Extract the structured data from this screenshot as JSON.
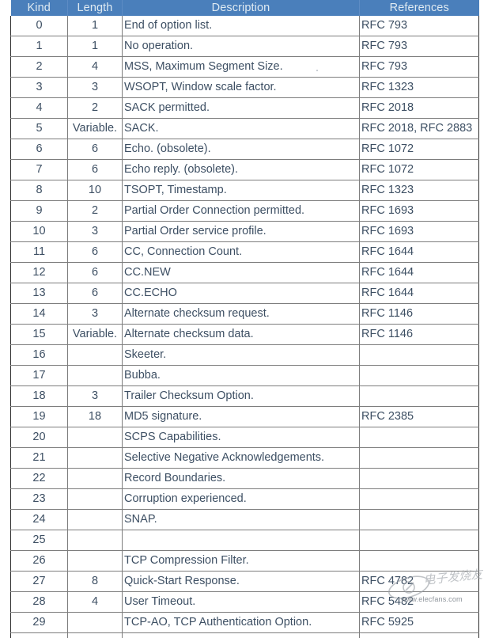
{
  "table": {
    "headers": {
      "kind": "Kind",
      "length": "Length",
      "description": "Description",
      "references": "References"
    },
    "rows": [
      {
        "kind": "0",
        "length": "1",
        "description": "End of option list.",
        "references": "RFC 793"
      },
      {
        "kind": "1",
        "length": "1",
        "description": "No operation.",
        "references": "RFC 793"
      },
      {
        "kind": "2",
        "length": "4",
        "description": "MSS, Maximum Segment Size.",
        "references": "RFC 793"
      },
      {
        "kind": "3",
        "length": "3",
        "description": "WSOPT, Window scale factor.",
        "references": "RFC 1323"
      },
      {
        "kind": "4",
        "length": "2",
        "description": "SACK permitted.",
        "references": "RFC 2018"
      },
      {
        "kind": "5",
        "length": "Variable.",
        "description": "SACK.",
        "references": "RFC 2018, RFC 2883"
      },
      {
        "kind": "6",
        "length": "6",
        "description": "Echo. (obsolete).",
        "references": "RFC 1072"
      },
      {
        "kind": "7",
        "length": "6",
        "description": "Echo reply. (obsolete).",
        "references": "RFC 1072"
      },
      {
        "kind": "8",
        "length": "10",
        "description": "TSOPT, Timestamp.",
        "references": "RFC 1323"
      },
      {
        "kind": "9",
        "length": "2",
        "description": "Partial Order Connection permitted.",
        "references": "RFC 1693"
      },
      {
        "kind": "10",
        "length": "3",
        "description": "Partial Order service profile.",
        "references": "RFC 1693"
      },
      {
        "kind": "11",
        "length": "6",
        "description": "CC, Connection Count.",
        "references": "RFC 1644"
      },
      {
        "kind": "12",
        "length": "6",
        "description": "CC.NEW",
        "references": "RFC 1644"
      },
      {
        "kind": "13",
        "length": "6",
        "description": "CC.ECHO",
        "references": "RFC 1644"
      },
      {
        "kind": "14",
        "length": "3",
        "description": "Alternate checksum request.",
        "references": "RFC 1146"
      },
      {
        "kind": "15",
        "length": "Variable.",
        "description": "Alternate checksum data.",
        "references": "RFC 1146"
      },
      {
        "kind": "16",
        "length": "",
        "description": "Skeeter.",
        "references": ""
      },
      {
        "kind": "17",
        "length": "",
        "description": "Bubba.",
        "references": ""
      },
      {
        "kind": "18",
        "length": "3",
        "description": "Trailer Checksum Option.",
        "references": ""
      },
      {
        "kind": "19",
        "length": "18",
        "description": "MD5 signature.",
        "references": "RFC 2385"
      },
      {
        "kind": "20",
        "length": "",
        "description": "SCPS Capabilities.",
        "references": ""
      },
      {
        "kind": "21",
        "length": "",
        "description": "Selective Negative Acknowledgements.",
        "references": ""
      },
      {
        "kind": "22",
        "length": "",
        "description": "Record Boundaries.",
        "references": ""
      },
      {
        "kind": "23",
        "length": "",
        "description": "Corruption experienced.",
        "references": ""
      },
      {
        "kind": "24",
        "length": "",
        "description": "SNAP.",
        "references": ""
      },
      {
        "kind": "25",
        "length": "",
        "description": "",
        "references": ""
      },
      {
        "kind": "26",
        "length": "",
        "description": "TCP Compression Filter.",
        "references": ""
      },
      {
        "kind": "27",
        "length": "8",
        "description": "Quick-Start Response.",
        "references": "RFC 4782"
      },
      {
        "kind": "28",
        "length": "4",
        "description": "User Timeout.",
        "references": "RFC 5482"
      },
      {
        "kind": "29",
        "length": "",
        "description": "TCP-AO, TCP Authentication Option.",
        "references": "RFC 5925"
      }
    ]
  },
  "watermark": {
    "site": "www.elecfans.com"
  },
  "colors": {
    "header_background": "#4a7fbb",
    "header_text": "#dfeaf2",
    "body_text": "#3d4f63",
    "grid_line": "#7d7d7d",
    "outer_border": "#2f2f2f"
  }
}
